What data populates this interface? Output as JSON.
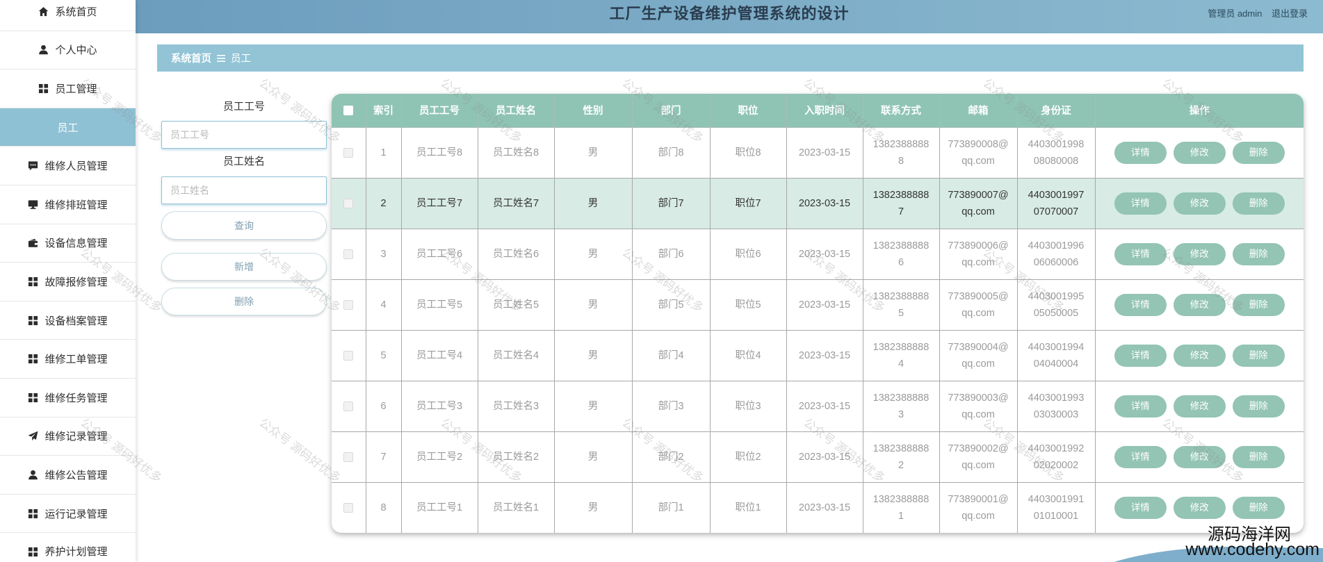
{
  "app": {
    "title": "工厂生产设备维护管理系统的设计"
  },
  "header": {
    "user_label": "管理员 admin",
    "logout_label": "退出登录"
  },
  "sidebar": {
    "items": [
      {
        "label": "系统首页",
        "icon": "home-icon"
      },
      {
        "label": "个人中心",
        "icon": "user-icon"
      },
      {
        "label": "员工管理",
        "icon": "grid-icon"
      },
      {
        "label": "员工",
        "active": true
      },
      {
        "label": "维修人员管理",
        "icon": "chat-icon"
      },
      {
        "label": "维修排班管理",
        "icon": "monitor-icon"
      },
      {
        "label": "设备信息管理",
        "icon": "wallet-icon"
      },
      {
        "label": "故障报修管理",
        "icon": "grid-icon"
      },
      {
        "label": "设备档案管理",
        "icon": "grid-icon"
      },
      {
        "label": "维修工单管理",
        "icon": "grid-icon"
      },
      {
        "label": "维修任务管理",
        "icon": "grid-icon"
      },
      {
        "label": "维修记录管理",
        "icon": "send-icon"
      },
      {
        "label": "维修公告管理",
        "icon": "user-icon"
      },
      {
        "label": "运行记录管理",
        "icon": "grid-icon"
      },
      {
        "label": "养护计划管理",
        "icon": "grid-icon"
      }
    ]
  },
  "breadcrumb": {
    "home": "系统首页",
    "separator_icon": "menu-icon",
    "current": "员工"
  },
  "search": {
    "fields": [
      {
        "label": "员工工号",
        "placeholder": "员工工号"
      },
      {
        "label": "员工姓名",
        "placeholder": "员工姓名"
      }
    ],
    "query_button": "查询",
    "add_button": "新增",
    "delete_button": "删除"
  },
  "table": {
    "columns": [
      "索引",
      "员工工号",
      "员工姓名",
      "性别",
      "部门",
      "职位",
      "入职时间",
      "联系方式",
      "邮箱",
      "身份证",
      "操作"
    ],
    "actions": {
      "detail": "详情",
      "edit": "修改",
      "delete": "删除"
    },
    "rows": [
      {
        "index": 1,
        "employee_id": "员工工号8",
        "employee_name": "员工姓名8",
        "gender": "男",
        "department": "部门8",
        "position": "职位8",
        "hire_date": "2023-03-15",
        "phone": "13823888888",
        "email": "773890008@qq.com",
        "id_card": "440300199808080008"
      },
      {
        "index": 2,
        "employee_id": "员工工号7",
        "employee_name": "员工姓名7",
        "gender": "男",
        "department": "部门7",
        "position": "职位7",
        "hire_date": "2023-03-15",
        "phone": "13823888887",
        "email": "773890007@qq.com",
        "id_card": "440300199707070007",
        "hovered": true
      },
      {
        "index": 3,
        "employee_id": "员工工号6",
        "employee_name": "员工姓名6",
        "gender": "男",
        "department": "部门6",
        "position": "职位6",
        "hire_date": "2023-03-15",
        "phone": "13823888886",
        "email": "773890006@qq.com",
        "id_card": "440300199606060006"
      },
      {
        "index": 4,
        "employee_id": "员工工号5",
        "employee_name": "员工姓名5",
        "gender": "男",
        "department": "部门5",
        "position": "职位5",
        "hire_date": "2023-03-15",
        "phone": "13823888885",
        "email": "773890005@qq.com",
        "id_card": "440300199505050005"
      },
      {
        "index": 5,
        "employee_id": "员工工号4",
        "employee_name": "员工姓名4",
        "gender": "男",
        "department": "部门4",
        "position": "职位4",
        "hire_date": "2023-03-15",
        "phone": "13823888884",
        "email": "773890004@qq.com",
        "id_card": "440300199404040004"
      },
      {
        "index": 6,
        "employee_id": "员工工号3",
        "employee_name": "员工姓名3",
        "gender": "男",
        "department": "部门3",
        "position": "职位3",
        "hire_date": "2023-03-15",
        "phone": "13823888883",
        "email": "773890003@qq.com",
        "id_card": "440300199303030003"
      },
      {
        "index": 7,
        "employee_id": "员工工号2",
        "employee_name": "员工姓名2",
        "gender": "男",
        "department": "部门2",
        "position": "职位2",
        "hire_date": "2023-03-15",
        "phone": "13823888882",
        "email": "773890002@qq.com",
        "id_card": "440300199202020002"
      },
      {
        "index": 8,
        "employee_id": "员工工号1",
        "employee_name": "员工姓名1",
        "gender": "男",
        "department": "部门1",
        "position": "职位1",
        "hire_date": "2023-03-15",
        "phone": "13823888881",
        "email": "773890001@qq.com",
        "id_card": "440300199101010001"
      }
    ]
  },
  "watermark": {
    "text": "公众号 源码好优多"
  },
  "site_mark": {
    "name": "源码海洋网",
    "url": "www.codehy.com"
  },
  "colors": {
    "header_start": "#6c9dbd",
    "header_end": "#8cbad0",
    "breadcrumb": "#92c4d6",
    "sidebar_active": "#8fc1d5",
    "table_header": "#8fc4b5",
    "action_button": "#93c4b4",
    "hover_row": "#d8ebe5"
  }
}
